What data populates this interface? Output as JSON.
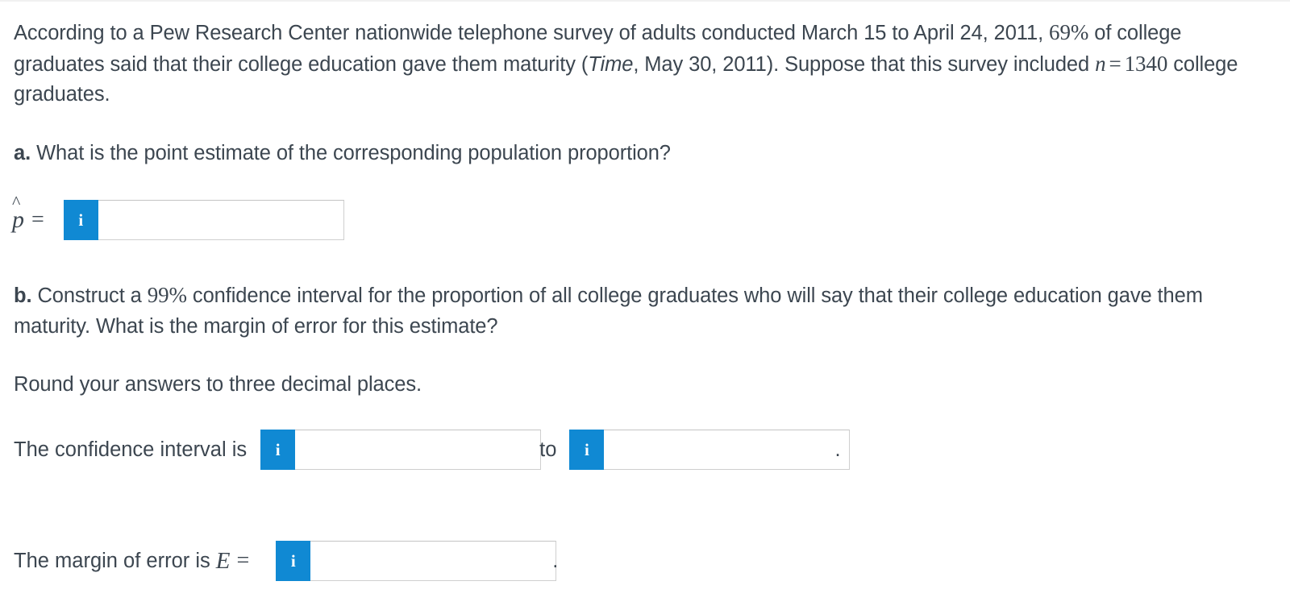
{
  "document": {
    "intro": {
      "text_before_time": "According to a Pew Research Center nationwide telephone survey of adults conducted March 15 to April 24, 2011, ",
      "percent": "69%",
      "text_after_percent": " of college graduates said that their college education gave them maturity (",
      "source_italic": "Time",
      "text_after_source": ", May 30, 2011). Suppose that this survey included ",
      "n_symbol": "n",
      "equals": "=",
      "n_value": "1340",
      "text_end": " college graduates."
    },
    "question_a": {
      "label": "a.",
      "text": " What is the point estimate of the corresponding population proportion?"
    },
    "question_b": {
      "label": "b.",
      "text_before_level": " Construct a ",
      "confidence_level": "99%",
      "text_after_level": " confidence interval for the proportion of all college graduates who will say that their college education gave them maturity. What is the margin of error for this estimate?"
    },
    "rounding_note": "Round your answers to three decimal places."
  },
  "answers": {
    "point_estimate": {
      "symbol_base": "p",
      "symbol_hat": "^",
      "equals": "=",
      "info_icon_label": "i",
      "value": "",
      "placeholder": ""
    },
    "confidence_interval": {
      "prefix_label": "The confidence interval is",
      "lower": {
        "info_icon_label": "i",
        "value": "",
        "placeholder": ""
      },
      "join_word": "to",
      "upper": {
        "info_icon_label": "i",
        "value": "",
        "placeholder": ""
      },
      "trailing_punctuation": "."
    },
    "margin_of_error": {
      "prefix_label": "The margin of error is",
      "symbol": "E",
      "equals": "=",
      "info_icon_label": "i",
      "value": "",
      "placeholder": "",
      "trailing_punctuation": "."
    }
  },
  "theme": {
    "accent_blue": "#1089d3",
    "text_color": "#3c4650",
    "input_border": "#cfcfcf",
    "background": "#ffffff"
  }
}
